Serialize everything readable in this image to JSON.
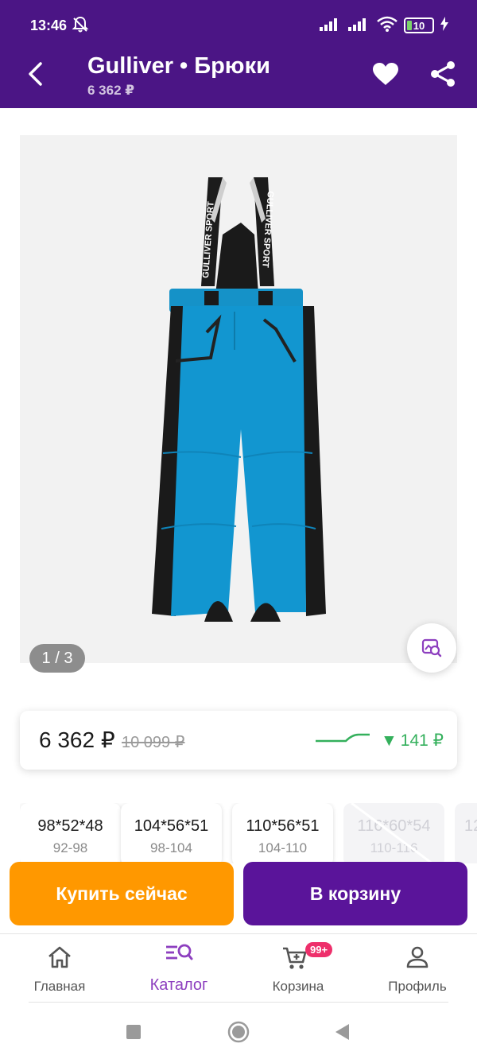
{
  "status_bar": {
    "time": "13:46",
    "battery": "10"
  },
  "app_bar": {
    "title": "Gulliver • Брюки",
    "subtitle": "6 362 ₽"
  },
  "gallery": {
    "page_indicator": "1 / 3",
    "strap_text": "GULLIVER SPORT"
  },
  "price": {
    "current": "6 362 ₽",
    "old": "10 099 ₽",
    "drop": "141 ₽",
    "drop_arrow": "▼",
    "colors": {
      "drop": "#34b05c",
      "old": "#9a9a9a"
    }
  },
  "sizes": [
    {
      "label": "98*52*48",
      "range": "92-98",
      "available": true
    },
    {
      "label": "104*56*51",
      "range": "98-104",
      "available": true
    },
    {
      "label": "110*56*51",
      "range": "104-110",
      "available": true
    },
    {
      "label": "116*60*54",
      "range": "110-116",
      "available": false
    },
    {
      "label": "12",
      "range": "",
      "available": false
    }
  ],
  "actions": {
    "buy_now": "Купить сейчас",
    "add_to_cart": "В корзину"
  },
  "bottom_nav": {
    "items": [
      {
        "label": "Главная",
        "icon": "home-icon"
      },
      {
        "label": "Каталог",
        "icon": "catalog-search-icon",
        "active": true
      },
      {
        "label": "Корзина",
        "icon": "cart-icon",
        "badge": "99+"
      },
      {
        "label": "Профиль",
        "icon": "profile-icon"
      }
    ]
  },
  "colors": {
    "brand": "#4b1585",
    "buy": "#ff9800",
    "cart": "#5a149a",
    "accent": "#8d3fbf",
    "badge": "#ee2f6b"
  }
}
